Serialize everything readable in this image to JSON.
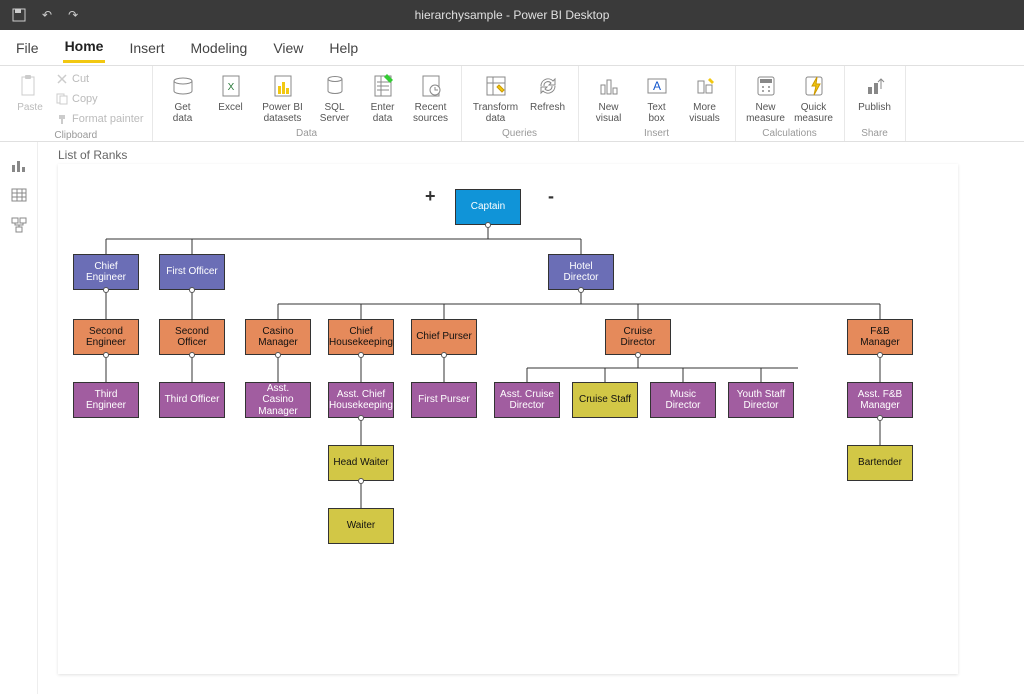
{
  "app": {
    "title": "hierarchysample - Power BI Desktop"
  },
  "menu": {
    "file": "File",
    "home": "Home",
    "insert": "Insert",
    "modeling": "Modeling",
    "view": "View",
    "help": "Help"
  },
  "ribbon": {
    "clipboard": {
      "label": "Clipboard",
      "paste": "Paste",
      "cut": "Cut",
      "copy": "Copy",
      "format": "Format painter"
    },
    "data": {
      "label": "Data",
      "get": "Get\ndata",
      "excel": "Excel",
      "pbi": "Power BI\ndatasets",
      "sql": "SQL\nServer",
      "enter": "Enter\ndata",
      "recent": "Recent\nsources"
    },
    "queries": {
      "label": "Queries",
      "transform": "Transform\ndata",
      "refresh": "Refresh"
    },
    "insert": {
      "label": "Insert",
      "newvis": "New\nvisual",
      "textbox": "Text\nbox",
      "morevis": "More\nvisuals"
    },
    "calc": {
      "label": "Calculations",
      "newmeas": "New\nmeasure",
      "quickmeas": "Quick\nmeasure"
    },
    "share": {
      "label": "Share",
      "publish": "Publish"
    }
  },
  "visual": {
    "title": "List of Ranks",
    "expand": "+",
    "collapse": "-"
  },
  "nodes": {
    "captain": "Captain",
    "chiefeng": "Chief Engineer",
    "firstoff": "First Officer",
    "hoteldir": "Hotel Director",
    "seceng": "Second Engineer",
    "secoff": "Second Officer",
    "casino": "Casino Manager",
    "chiefhk": "Chief Housekeeping",
    "chiefpurser": "Chief Purser",
    "cruisedir": "Cruise Director",
    "fbmgr": "F&B Manager",
    "thirdeng": "Third Engineer",
    "thirdoff": "Third Officer",
    "asstcasino": "Asst. Casino Manager",
    "asstchiefhk": "Asst. Chief Housekeeping",
    "firstpurser": "First Purser",
    "asstcruise": "Asst. Cruise Director",
    "cruisestaff": "Cruise Staff",
    "musicdir": "Music Director",
    "youthstaff": "Youth Staff Director",
    "asstfb": "Asst. F&B Manager",
    "headwaiter": "Head Waiter",
    "bartender": "Bartender",
    "waiter": "Waiter"
  }
}
